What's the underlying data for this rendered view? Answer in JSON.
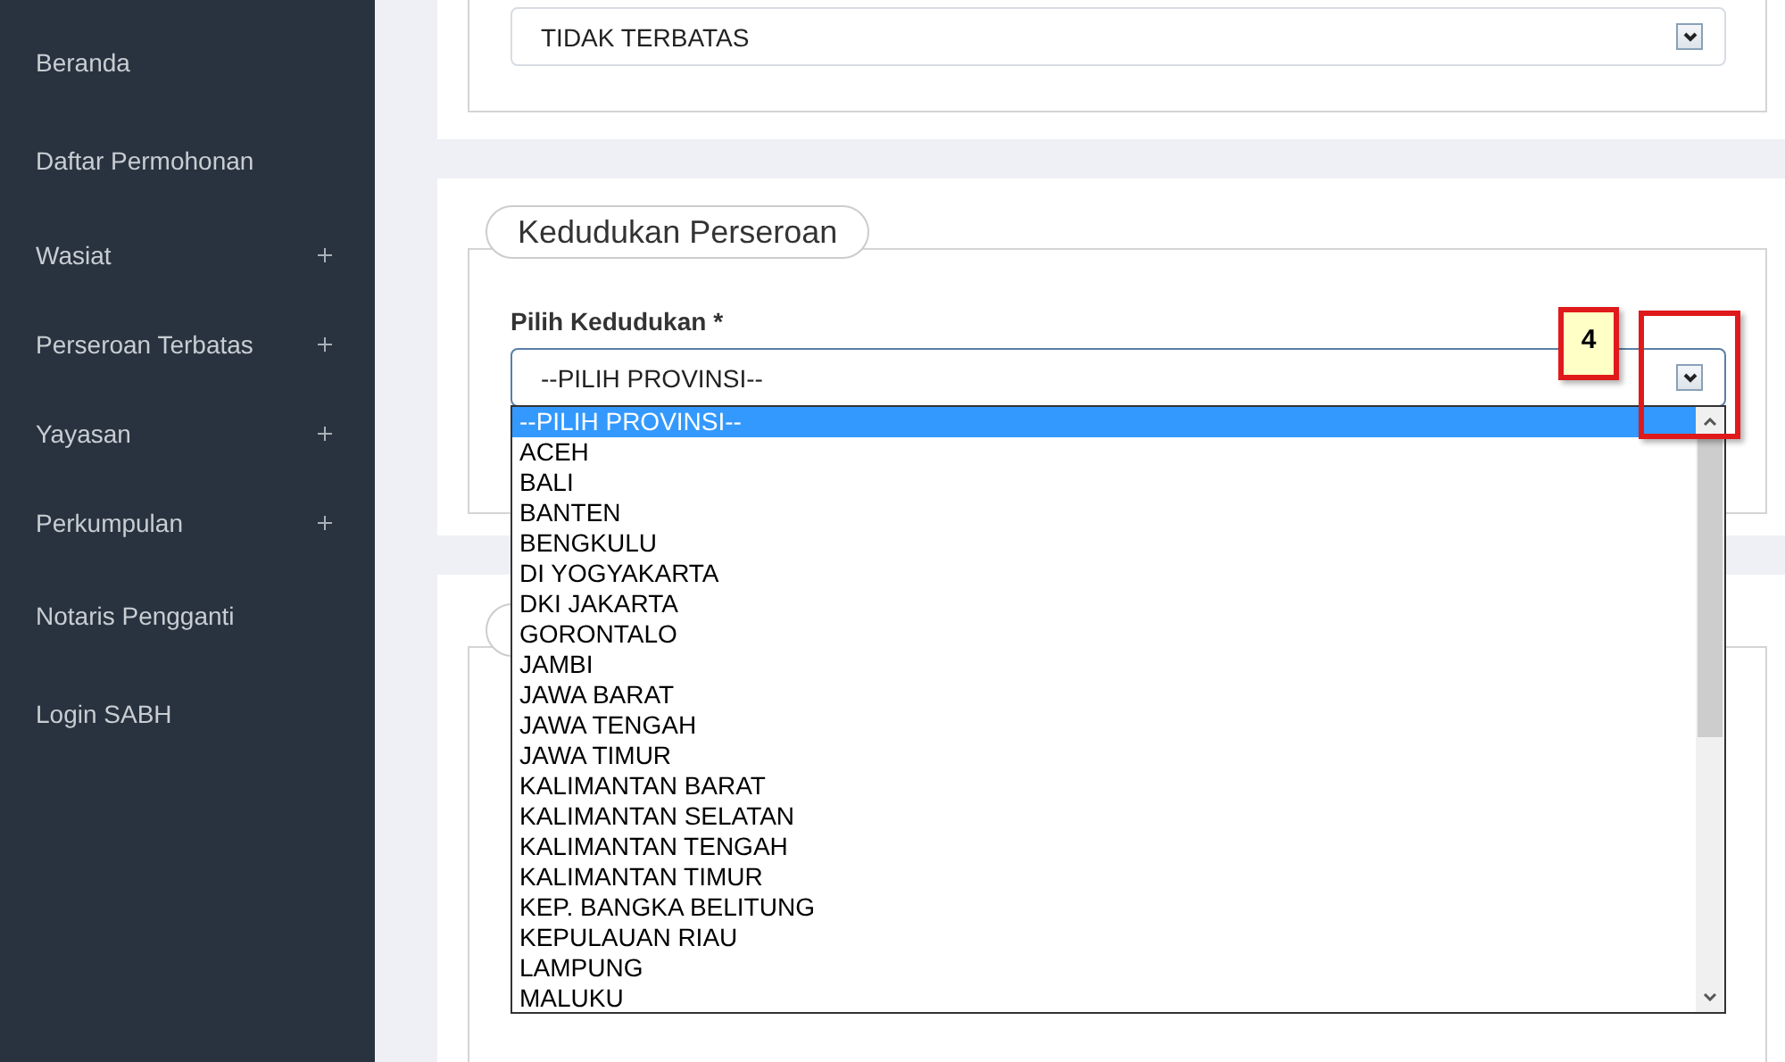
{
  "sidebar": {
    "items": [
      {
        "label": "Beranda",
        "expandable": false
      },
      {
        "label": "Daftar Permohonan",
        "expandable": false
      },
      {
        "label": "Wasiat",
        "expandable": true
      },
      {
        "label": "Perseroan Terbatas",
        "expandable": true
      },
      {
        "label": "Yayasan",
        "expandable": true
      },
      {
        "label": "Perkumpulan",
        "expandable": true
      },
      {
        "label": "Notaris Pengganti",
        "expandable": false
      },
      {
        "label": "Login SABH",
        "expandable": false
      }
    ]
  },
  "top_section": {
    "select": {
      "value": "TIDAK TERBATAS"
    }
  },
  "kedudukan_section": {
    "title": "Kedudukan Perseroan",
    "label": "Pilih Kedudukan *",
    "select": {
      "value": "--PILIH PROVINSI--",
      "expanded": true
    },
    "options": [
      {
        "label": "--PILIH PROVINSI--",
        "selected": true
      },
      {
        "label": "ACEH",
        "selected": false
      },
      {
        "label": "BALI",
        "selected": false
      },
      {
        "label": "BANTEN",
        "selected": false
      },
      {
        "label": "BENGKULU",
        "selected": false
      },
      {
        "label": "DI YOGYAKARTA",
        "selected": false
      },
      {
        "label": "DKI JAKARTA",
        "selected": false
      },
      {
        "label": "GORONTALO",
        "selected": false
      },
      {
        "label": "JAMBI",
        "selected": false
      },
      {
        "label": "JAWA BARAT",
        "selected": false
      },
      {
        "label": "JAWA TENGAH",
        "selected": false
      },
      {
        "label": "JAWA TIMUR",
        "selected": false
      },
      {
        "label": "KALIMANTAN BARAT",
        "selected": false
      },
      {
        "label": "KALIMANTAN SELATAN",
        "selected": false
      },
      {
        "label": "KALIMANTAN TENGAH",
        "selected": false
      },
      {
        "label": "KALIMANTAN TIMUR",
        "selected": false
      },
      {
        "label": "KEP. BANGKA BELITUNG",
        "selected": false
      },
      {
        "label": "KEPULAUAN RIAU",
        "selected": false
      },
      {
        "label": "LAMPUNG",
        "selected": false
      },
      {
        "label": "MALUKU",
        "selected": false
      }
    ]
  },
  "annotation": {
    "step": "4"
  }
}
